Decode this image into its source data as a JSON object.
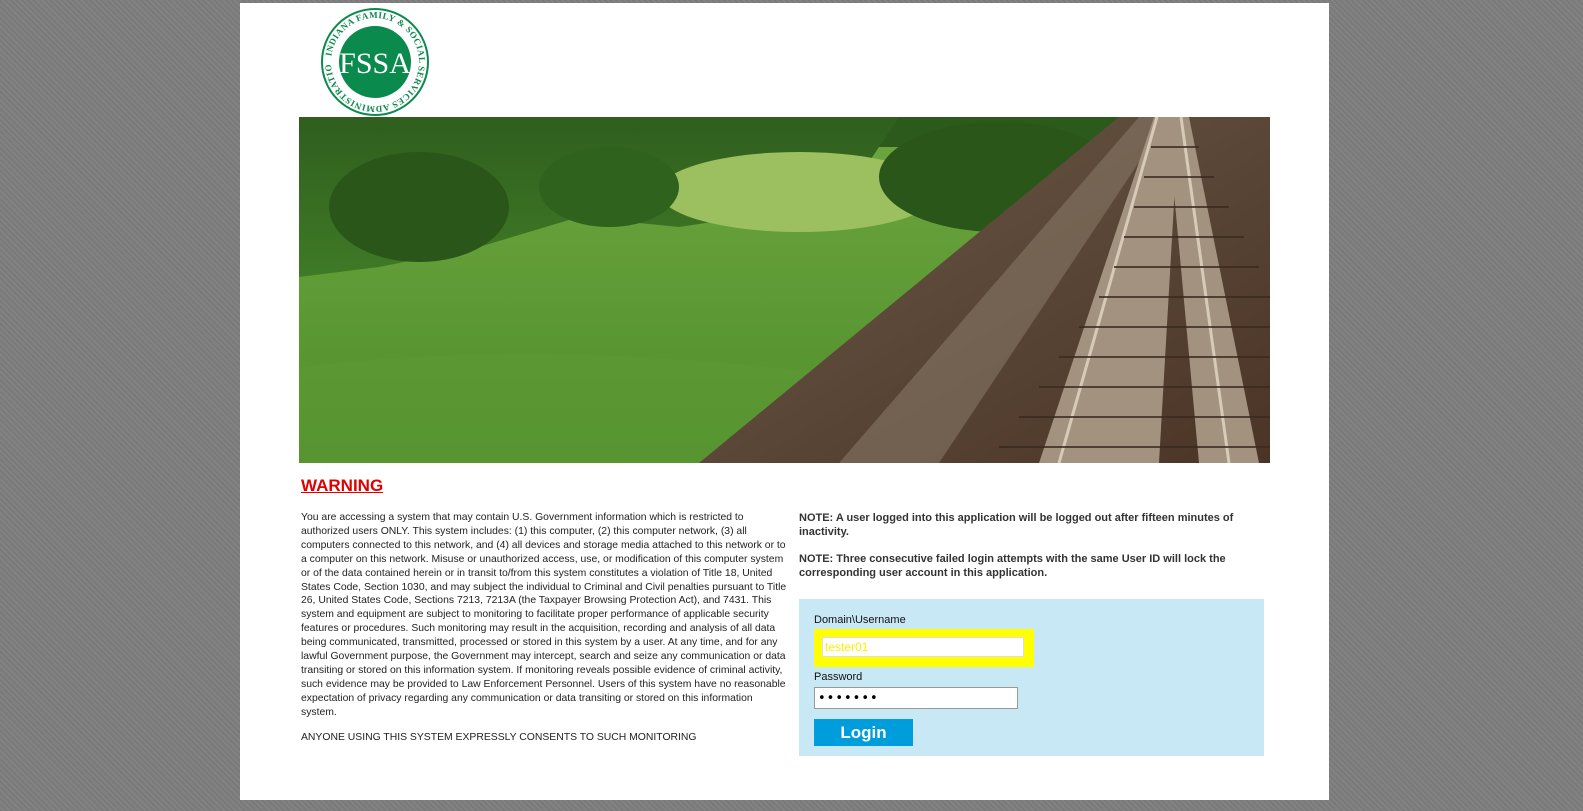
{
  "logo": {
    "ring_text": "INDIANA FAMILY & SOCIAL SERVICES ADMINISTRATION",
    "monogram": "FSSA",
    "color": "#0a8a4c"
  },
  "warning": {
    "title": "WARNING",
    "body": "You are accessing a system that may contain U.S. Government information which is restricted to authorized users ONLY. This system includes: (1) this computer, (2) this computer network, (3) all computers connected to this network, and (4) all devices and storage media attached to this network or to a computer on this network. Misuse or unauthorized access, use, or modification of this computer system or of the data contained herein or in transit to/from this system constitutes a violation of Title 18, United States Code, Section 1030, and may subject the individual to Criminal and Civil penalties pursuant to Title 26, United States Code, Sections 7213, 7213A (the Taxpayer Browsing Protection Act), and 7431. This system and equipment are subject to monitoring to facilitate proper performance of applicable security features or procedures. Such monitoring may result in the acquisition, recording and analysis of all data being communicated, transmitted, processed or stored in this system by a user. At any time, and for any lawful Government purpose, the Government may intercept, search and seize any communication or data transiting or stored on this information system. If monitoring reveals possible evidence of criminal activity, such evidence may be provided to Law Enforcement Personnel. Users of this system have no reasonable expectation of privacy regarding any communication or data transiting or stored on this information system.",
    "consent": "ANYONE USING THIS SYSTEM EXPRESSLY CONSENTS TO SUCH MONITORING"
  },
  "notes": [
    "NOTE: A user logged into this application will be logged out after fifteen minutes of inactivity.",
    "NOTE: Three consecutive failed login attempts with the same User ID will lock the corresponding user account in this application."
  ],
  "login": {
    "username_label": "Domain\\Username",
    "username_value": "tester01",
    "password_label": "Password",
    "password_value": "•••••••",
    "button_label": "Login",
    "highlight_color": "#ffff00",
    "button_color": "#009ddc",
    "panel_color": "#c9e8f5"
  }
}
